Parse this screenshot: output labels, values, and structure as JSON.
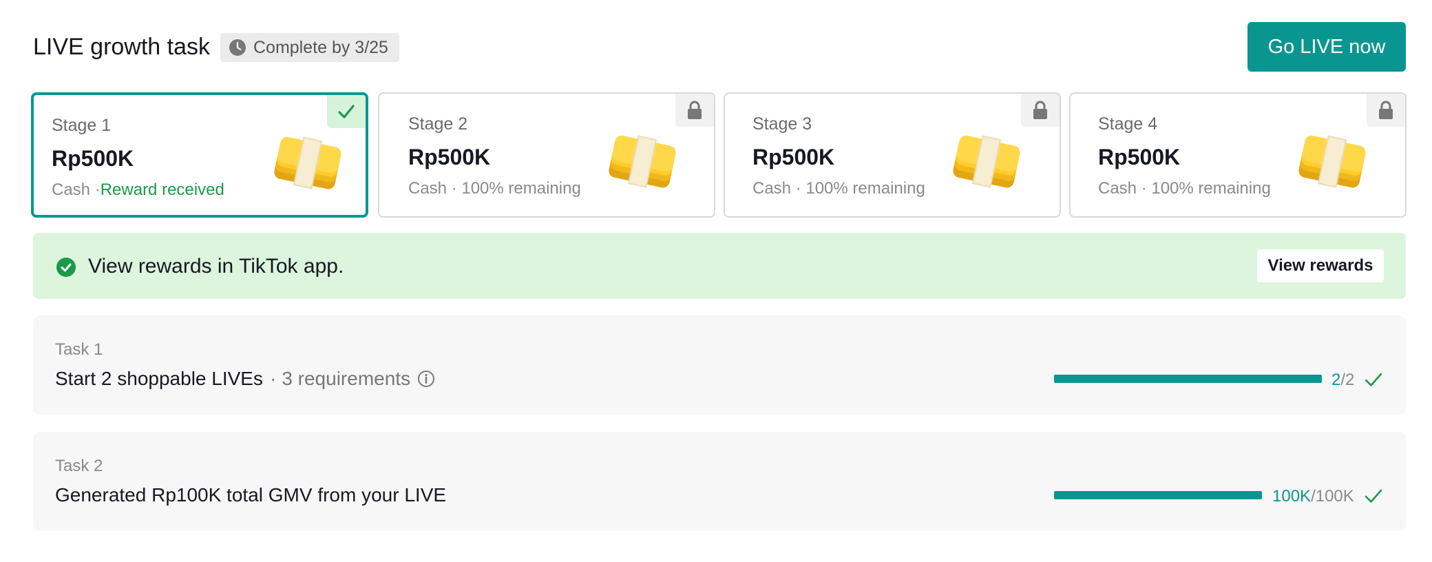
{
  "header": {
    "title": "LIVE growth task",
    "deadline": "Complete by 3/25",
    "go_live_label": "Go LIVE now"
  },
  "colors": {
    "accent": "#0a9690",
    "success": "#1a9a4a",
    "notice_bg": "#dcf5dc"
  },
  "stages": [
    {
      "name": "Stage 1",
      "amount": "Rp500K",
      "type": "Cash",
      "sep": " ·",
      "status": "Reward received",
      "state": "completed",
      "corner_icon": "check-icon"
    },
    {
      "name": "Stage 2",
      "amount": "Rp500K",
      "type": "Cash",
      "sep": " · ",
      "status": "100% remaining",
      "state": "locked",
      "corner_icon": "lock-icon"
    },
    {
      "name": "Stage 3",
      "amount": "Rp500K",
      "type": "Cash",
      "sep": " · ",
      "status": "100% remaining",
      "state": "locked",
      "corner_icon": "lock-icon"
    },
    {
      "name": "Stage 4",
      "amount": "Rp500K",
      "type": "Cash",
      "sep": " · ",
      "status": "100% remaining",
      "state": "locked",
      "corner_icon": "lock-icon"
    }
  ],
  "notice": {
    "text": "View rewards in TikTok app.",
    "button_label": "View rewards",
    "icon": "check-circle-icon"
  },
  "tasks": [
    {
      "label": "Task 1",
      "title": "Start 2 shoppable LIVEs",
      "sep": "·",
      "requirements": "3 requirements",
      "done": "2",
      "slash": "/",
      "total": "2",
      "progress": 1.0
    },
    {
      "label": "Task 2",
      "title": "Generated Rp100K total GMV from your LIVE",
      "done": "100K",
      "slash": "/",
      "total": "100K",
      "progress": 1.0
    }
  ]
}
